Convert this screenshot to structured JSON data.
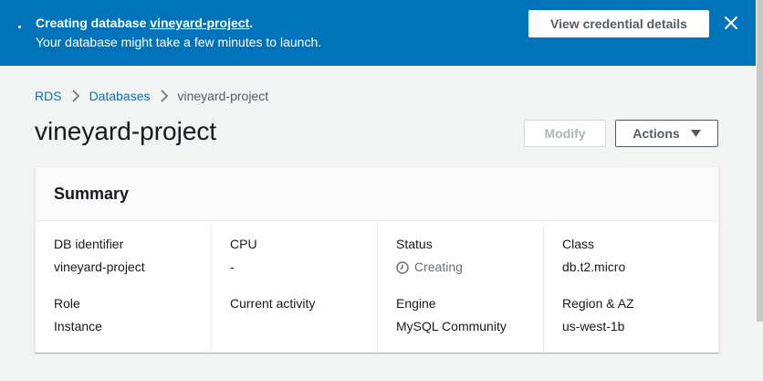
{
  "flash": {
    "prefix": "Creating database ",
    "db_link": "vineyard-project",
    "suffix": ".",
    "message": "Your database might take a few minutes to launch.",
    "credential_button": "View credential details",
    "close_icon": "close-icon",
    "color": "#0073bb"
  },
  "breadcrumb": {
    "items": [
      "RDS",
      "Databases"
    ],
    "current": "vineyard-project"
  },
  "page": {
    "title": "vineyard-project"
  },
  "toolbar": {
    "modify_label": "Modify",
    "actions_label": "Actions"
  },
  "summary": {
    "title": "Summary",
    "columns": [
      [
        {
          "label": "DB identifier",
          "value": "vineyard-project"
        },
        {
          "label": "Role",
          "value": "Instance"
        }
      ],
      [
        {
          "label": "CPU",
          "value": "-"
        },
        {
          "label": "Current activity",
          "value": ""
        }
      ],
      [
        {
          "label": "Status",
          "value": "Creating"
        },
        {
          "label": "Engine",
          "value": "MySQL Community"
        }
      ],
      [
        {
          "label": "Class",
          "value": "db.t2.micro"
        },
        {
          "label": "Region & AZ",
          "value": "us-west-1b"
        }
      ]
    ]
  }
}
